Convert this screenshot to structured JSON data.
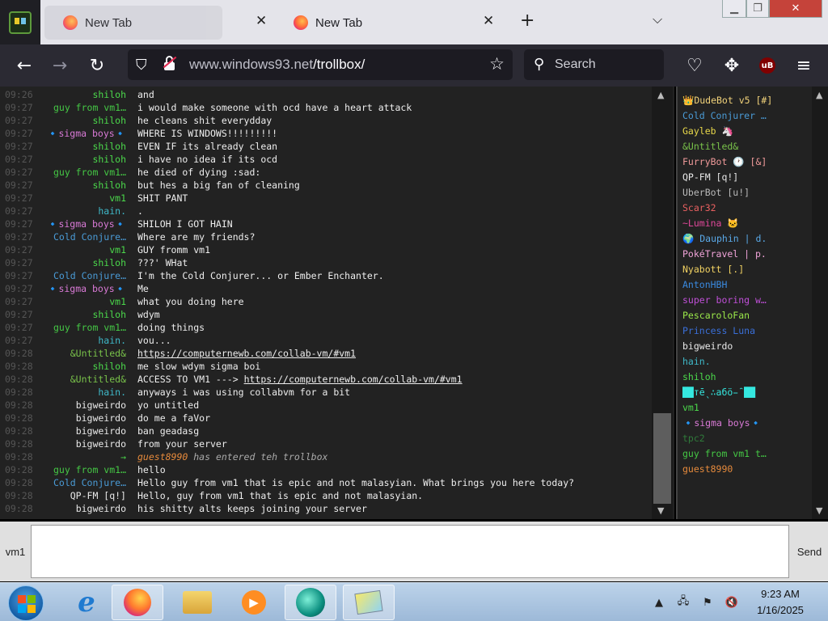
{
  "browser": {
    "tabs": [
      {
        "title": "New Tab"
      },
      {
        "title": "New Tab"
      }
    ],
    "url_host": "www.windows93.net",
    "url_path": "/trollbox/",
    "search_placeholder": "Search"
  },
  "colors": {
    "background": "#222222",
    "time": "#555555",
    "message": "#eeeeee"
  },
  "chat": {
    "messages": [
      {
        "time": "09:26",
        "nick": "shiloh",
        "color": "#4bd84b",
        "text": "and"
      },
      {
        "time": "09:27",
        "nick": "guy from vm1…",
        "color": "#45c845",
        "text": "i would make someone with ocd have a heart attack"
      },
      {
        "time": "09:27",
        "nick": "shiloh",
        "color": "#4bd84b",
        "text": "he cleans shit everydday"
      },
      {
        "time": "09:27",
        "nick": "🔹sigma boys🔹",
        "color": "#d97ad6",
        "text": "WHERE IS WINDOWS!!!!!!!!!"
      },
      {
        "time": "09:27",
        "nick": "shiloh",
        "color": "#4bd84b",
        "text": "EVEN IF its already clean"
      },
      {
        "time": "09:27",
        "nick": "shiloh",
        "color": "#4bd84b",
        "text": "i have no idea if its ocd"
      },
      {
        "time": "09:27",
        "nick": "guy from vm1…",
        "color": "#45c845",
        "text": "he died of dying :sad:"
      },
      {
        "time": "09:27",
        "nick": "shiloh",
        "color": "#4bd84b",
        "text": "but hes a big fan of cleaning"
      },
      {
        "time": "09:27",
        "nick": "vm1",
        "color": "#4bd84b",
        "text": "SHIT PANT"
      },
      {
        "time": "09:27",
        "nick": "hain.",
        "color": "#3fb9c9",
        "text": "."
      },
      {
        "time": "09:27",
        "nick": "🔹sigma boys🔹",
        "color": "#d97ad6",
        "text": "SHILOH I GOT HAIN"
      },
      {
        "time": "09:27",
        "nick": "Cold Conjure…",
        "color": "#4a9bd6",
        "text": "Where are my friends?"
      },
      {
        "time": "09:27",
        "nick": "vm1",
        "color": "#4bd84b",
        "text": "GUY fromm vm1"
      },
      {
        "time": "09:27",
        "nick": "shiloh",
        "color": "#4bd84b",
        "text": "???' WHat"
      },
      {
        "time": "09:27",
        "nick": "Cold Conjure…",
        "color": "#4a9bd6",
        "text": "I'm the Cold Conjurer... or Ember Enchanter."
      },
      {
        "time": "09:27",
        "nick": "🔹sigma boys🔹",
        "color": "#d97ad6",
        "text": "Me"
      },
      {
        "time": "09:27",
        "nick": "vm1",
        "color": "#4bd84b",
        "text": "what you doing here"
      },
      {
        "time": "09:27",
        "nick": "shiloh",
        "color": "#4bd84b",
        "text": "wdym"
      },
      {
        "time": "09:27",
        "nick": "guy from vm1…",
        "color": "#45c845",
        "text": "doing things"
      },
      {
        "time": "09:27",
        "nick": "hain.",
        "color": "#3fb9c9",
        "text": "vou..."
      },
      {
        "time": "09:28",
        "nick": "&Untitled&",
        "color": "#79c24a",
        "text": "",
        "link": "https://computernewb.com/collab-vm/#vm1"
      },
      {
        "time": "09:28",
        "nick": "shiloh",
        "color": "#4bd84b",
        "text": "me slow wdym sigma boi"
      },
      {
        "time": "09:28",
        "nick": "&Untitled&",
        "color": "#79c24a",
        "text": "ACCESS TO VM1 ---> ",
        "link": "https://computernewb.com/collab-vm/#vm1"
      },
      {
        "time": "09:28",
        "nick": "hain.",
        "color": "#3fb9c9",
        "text": "anyways i was using collabvm for a bit"
      },
      {
        "time": "09:28",
        "nick": "bigweirdo",
        "color": "#e8e8e8",
        "text": "yo untitled"
      },
      {
        "time": "09:28",
        "nick": "bigweirdo",
        "color": "#e8e8e8",
        "text": "do me a faVor"
      },
      {
        "time": "09:28",
        "nick": "bigweirdo",
        "color": "#e8e8e8",
        "text": "ban geadasg"
      },
      {
        "time": "09:28",
        "nick": "bigweirdo",
        "color": "#e8e8e8",
        "text": "from your server"
      },
      {
        "time": "09:28",
        "nick": "→",
        "color": "#4bd84b",
        "text": "has entered teh trollbox",
        "join": "guest8990"
      },
      {
        "time": "09:28",
        "nick": "guy from vm1…",
        "color": "#45c845",
        "text": "hello"
      },
      {
        "time": "09:28",
        "nick": "Cold Conjure…",
        "color": "#4a9bd6",
        "text": "Hello guy from vm1 that is epic and not malasyian. What brings you here today?"
      },
      {
        "time": "09:28",
        "nick": "QP-FM [q!]",
        "color": "#e8e8e8",
        "text": "Hello, guy from vm1 that is epic and not malasyian."
      },
      {
        "time": "09:28",
        "nick": "bigweirdo",
        "color": "#e8e8e8",
        "text": "his shitty alts keeps joining your server"
      }
    ]
  },
  "users": [
    {
      "name": "👑DudeBot v5 [#]",
      "color": "#f1d27a"
    },
    {
      "name": "Cold Conjurer …",
      "color": "#4a9bd6"
    },
    {
      "name": "Gayleb 🦄",
      "color": "#e8d84a"
    },
    {
      "name": "&Untitled&",
      "color": "#79c24a"
    },
    {
      "name": "FurryBot 🕐 [&]",
      "color": "#f09a9a"
    },
    {
      "name": "QP-FM [q!]",
      "color": "#e8e8e8"
    },
    {
      "name": "UberBot [u!]",
      "color": "#b9b9b9"
    },
    {
      "name": "Scar32",
      "color": "#e86060"
    },
    {
      "name": "~Lumina 🐱",
      "color": "#e0489a"
    },
    {
      "name": "🌍 Dauphin | d.",
      "color": "#5aa9e8"
    },
    {
      "name": "PokéTravel | p.",
      "color": "#f0a3d8"
    },
    {
      "name": "Nyabott [.]",
      "color": "#f2d262"
    },
    {
      "name": "AntonHBH",
      "color": "#3a8ae0"
    },
    {
      "name": "super boring w…",
      "color": "#c050d8"
    },
    {
      "name": "PescaroloFan",
      "color": "#9be84a"
    },
    {
      "name": "Princess Luna",
      "color": "#3a6fd8"
    },
    {
      "name": "bigweirdo",
      "color": "#e8e8e8"
    },
    {
      "name": "hain.",
      "color": "#3fb9c9"
    },
    {
      "name": "shiloh",
      "color": "#4bd84b"
    },
    {
      "name": "██тēˎ∴абö̵̑ ██",
      "color": "#35e8e0"
    },
    {
      "name": "vm1",
      "color": "#4bd84b"
    },
    {
      "name": "🔹sigma boys🔹",
      "color": "#d97ad6"
    },
    {
      "name": "tpc2",
      "color": "#2f7a3a"
    },
    {
      "name": "guy from vm1 t…",
      "color": "#45c845"
    },
    {
      "name": "guest8990",
      "color": "#e68a3c"
    }
  ],
  "input": {
    "nick": "vm1",
    "value": "",
    "send_label": "Send"
  },
  "taskbar": {
    "time": "9:23 AM",
    "date": "1/16/2025",
    "apps": [
      "internet-explorer-icon",
      "firefox-icon",
      "file-explorer-icon",
      "media-player-icon",
      "chat-app-icon",
      "sticky-notes-icon"
    ]
  }
}
